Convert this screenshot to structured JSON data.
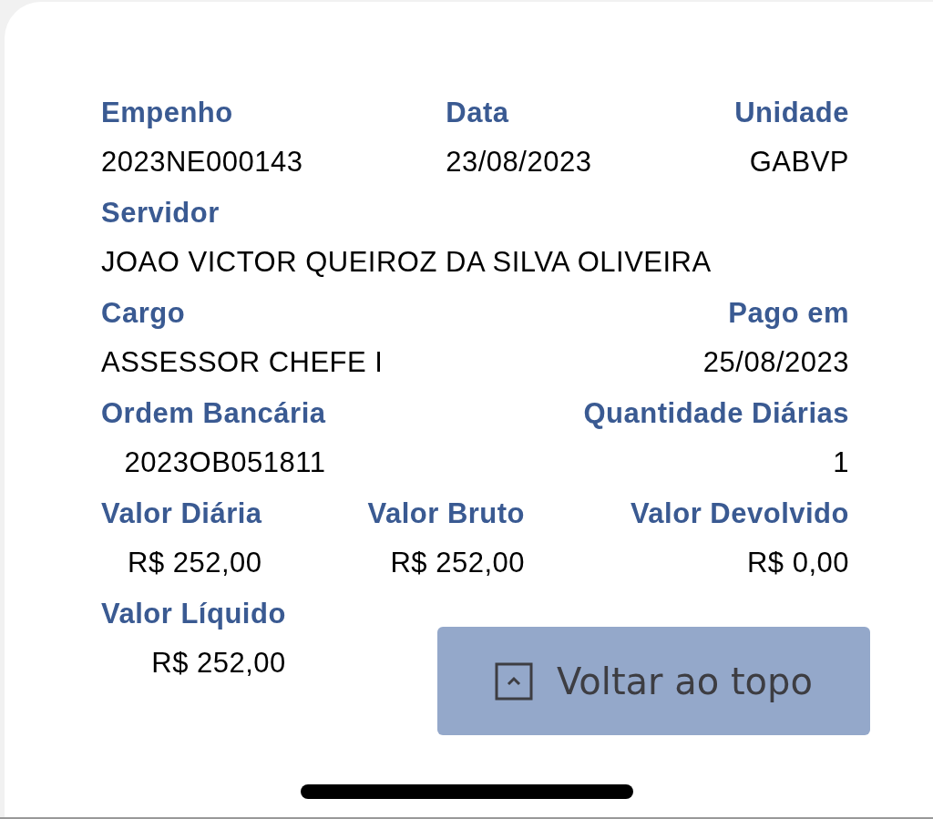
{
  "rows": [
    {
      "fields": [
        {
          "label": "Empenho",
          "value": "2023NE000143"
        },
        {
          "label": "Data",
          "value": "23/08/2023"
        },
        {
          "label": "Unidade",
          "value": "GABVP"
        }
      ]
    },
    {
      "fields": [
        {
          "label": "Servidor",
          "value": "JOAO VICTOR QUEIROZ DA SILVA OLIVEIRA"
        }
      ]
    },
    {
      "fields": [
        {
          "label": "Cargo",
          "value": "ASSESSOR CHEFE I"
        },
        {
          "label": "Pago em",
          "value": "25/08/2023"
        }
      ]
    },
    {
      "fields": [
        {
          "label": "Ordem Bancária",
          "value": "2023OB051811"
        },
        {
          "label": "Quantidade Diárias",
          "value": "1"
        }
      ]
    },
    {
      "fields": [
        {
          "label": "Valor Diária",
          "value": "R$ 252,00"
        },
        {
          "label": "Valor Bruto",
          "value": "R$ 252,00"
        },
        {
          "label": "Valor Devolvido",
          "value": "R$ 0,00"
        }
      ]
    },
    {
      "fields": [
        {
          "label": "Valor Líquido",
          "value": "R$ 252,00"
        }
      ]
    }
  ],
  "back_to_top": {
    "label": "Voltar ao topo"
  }
}
